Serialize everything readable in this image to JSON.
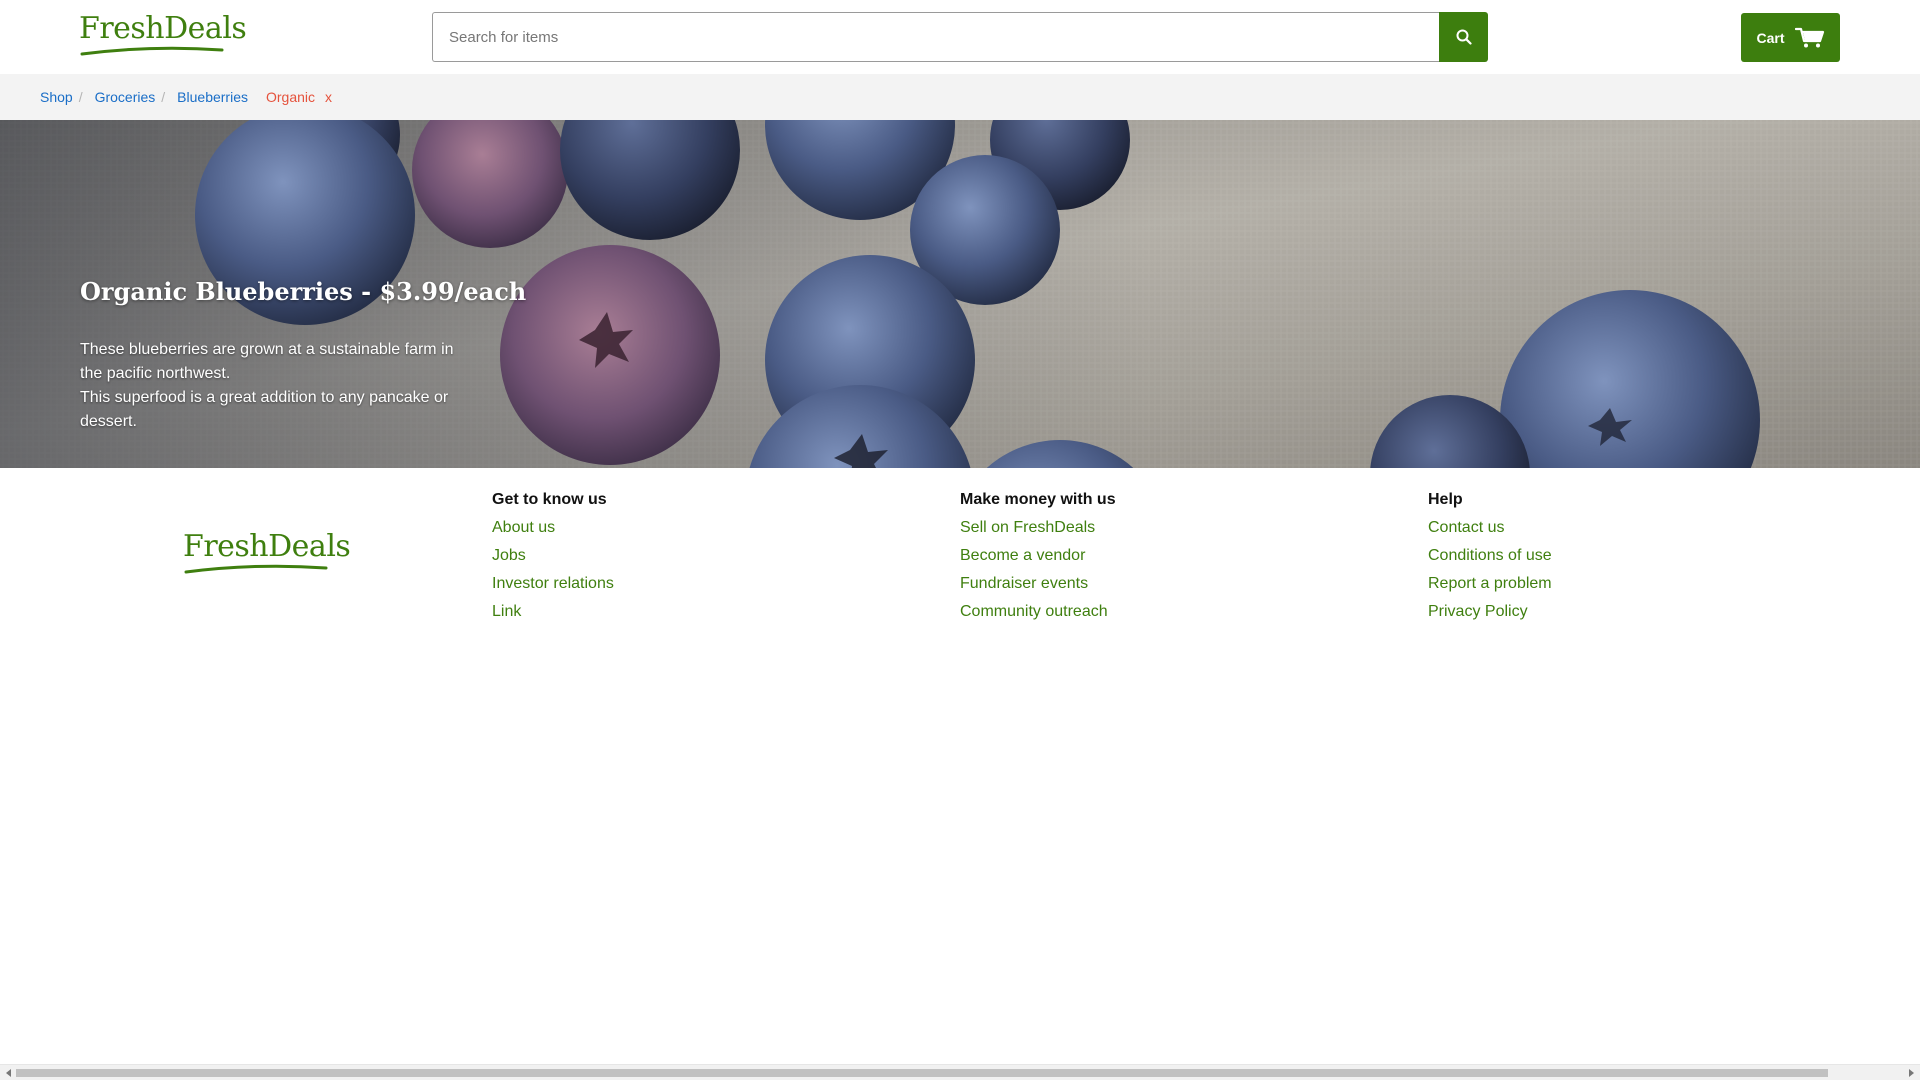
{
  "brand": {
    "name": "FreshDeals",
    "color": "#3f7f0f"
  },
  "header": {
    "search_placeholder": "Search for items",
    "search_icon": "search-icon",
    "cart_label": "Cart",
    "cart_icon": "cart-icon"
  },
  "breadcrumb": {
    "items": [
      "Shop",
      "Groceries",
      "Blueberries"
    ],
    "separator": "/",
    "active_filter": "Organic",
    "clear_label": "x"
  },
  "hero": {
    "title": "Organic Blueberries - $3.99/each",
    "lines": [
      "These blueberries are grown at a sustainable farm in the pacific northwest.",
      "This superfood is a great addition to any pancake or dessert."
    ]
  },
  "footer": {
    "columns": [
      {
        "heading": "Get to know us",
        "links": [
          "About us",
          "Jobs",
          "Investor relations",
          "Link"
        ]
      },
      {
        "heading": "Make money with us",
        "links": [
          "Sell on FreshDeals",
          "Become a vendor",
          "Fundraiser events",
          "Community outreach"
        ]
      },
      {
        "heading": "Help",
        "links": [
          "Contact us",
          "Conditions of use",
          "Report a problem",
          "Privacy Policy"
        ]
      }
    ]
  },
  "colors": {
    "accent": "#3d7e0e",
    "link_blue": "#1a6ec7",
    "filter_red": "#e5533d"
  }
}
